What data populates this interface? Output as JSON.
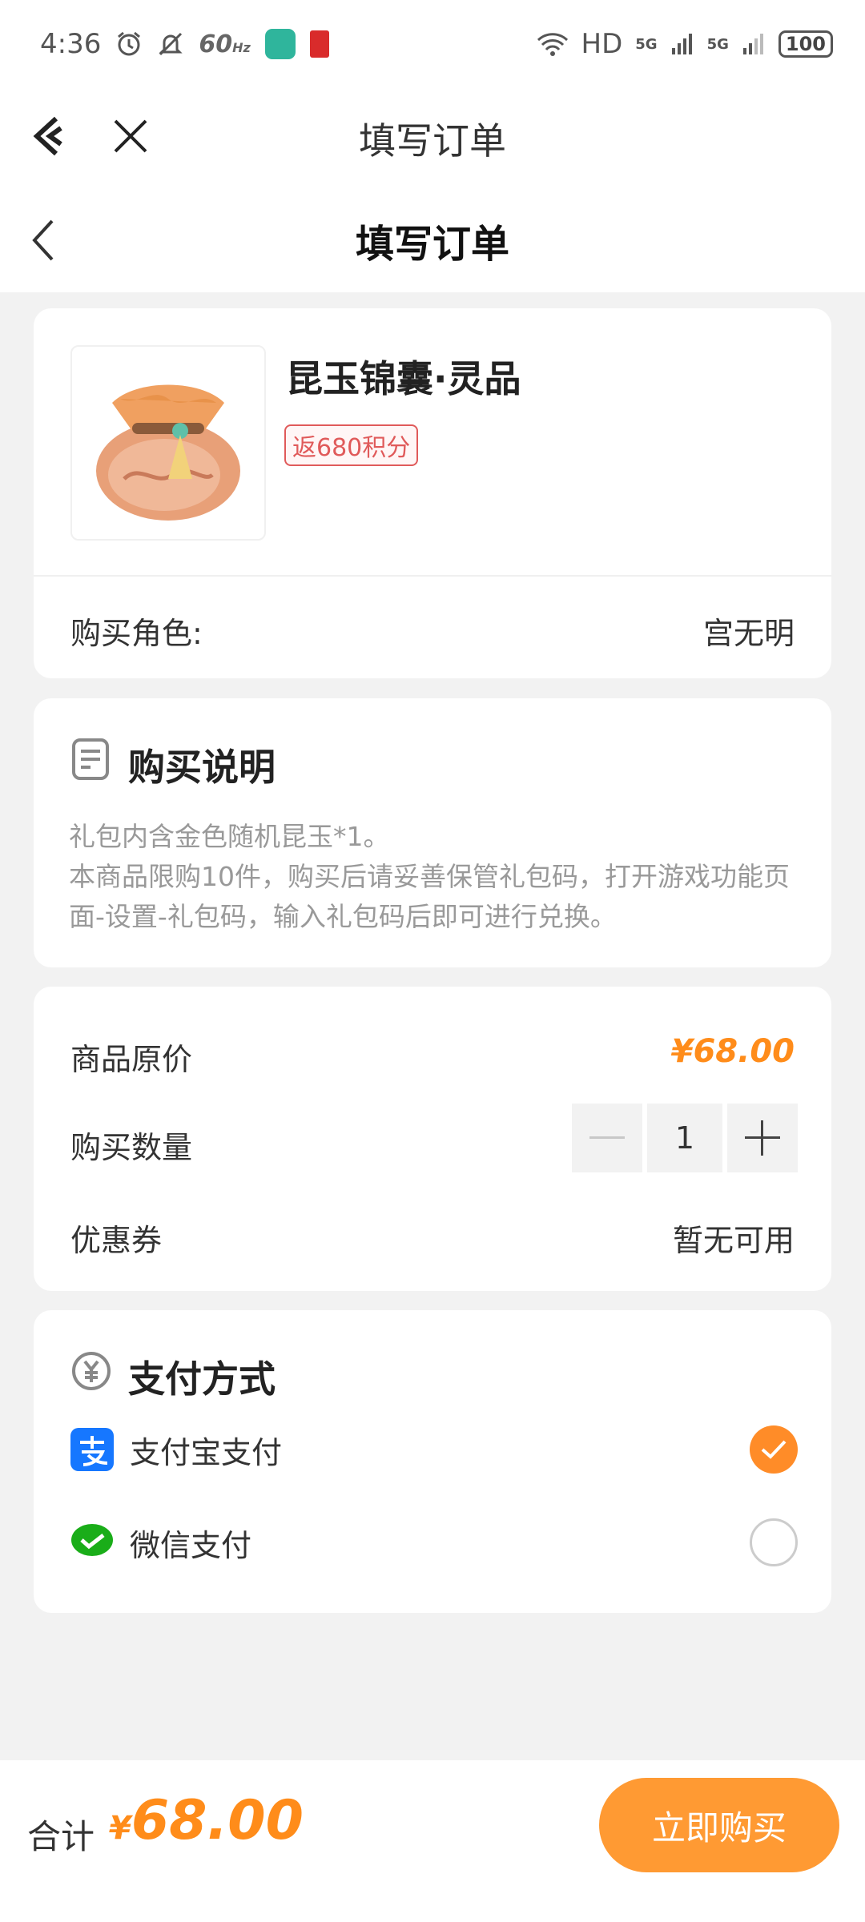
{
  "status_bar": {
    "time": "4:36",
    "refresh": "60",
    "refresh_unit": "Hz",
    "network": "HD",
    "sim1": "5G",
    "sim2": "5G",
    "battery": "100"
  },
  "mini_header": {
    "title": "填写订单"
  },
  "page_header": {
    "title": "填写订单"
  },
  "product": {
    "name": "昆玉锦囊·灵品",
    "points_badge": "返680积分",
    "role_label": "购买角色:",
    "role_value": "宫无明"
  },
  "description": {
    "title": "购买说明",
    "line1": "礼包内含金色随机昆玉*1。",
    "line2": "本商品限购10件，购买后请妥善保管礼包码，打开游戏功能页面-设置-礼包码，输入礼包码后即可进行兑换。"
  },
  "pricing": {
    "orig_label": "商品原价",
    "orig_value": "¥68.00",
    "qty_label": "购买数量",
    "qty_value": "1",
    "coupon_label": "优惠券",
    "coupon_value": "暂无可用"
  },
  "payment": {
    "title": "支付方式",
    "methods": [
      {
        "label": "支付宝支付",
        "selected": true,
        "icon": "alipay-icon"
      },
      {
        "label": "微信支付",
        "selected": false,
        "icon": "wechat-pay-icon"
      }
    ]
  },
  "footer": {
    "total_label": "合计",
    "currency": "¥",
    "total_value": "68.00",
    "buy_label": "立即购买"
  },
  "colors": {
    "accent": "#ff8c1a",
    "button": "#ff9a33",
    "badge": "#e05a5a",
    "alipay": "#1677ff",
    "wechat": "#1aad19"
  }
}
